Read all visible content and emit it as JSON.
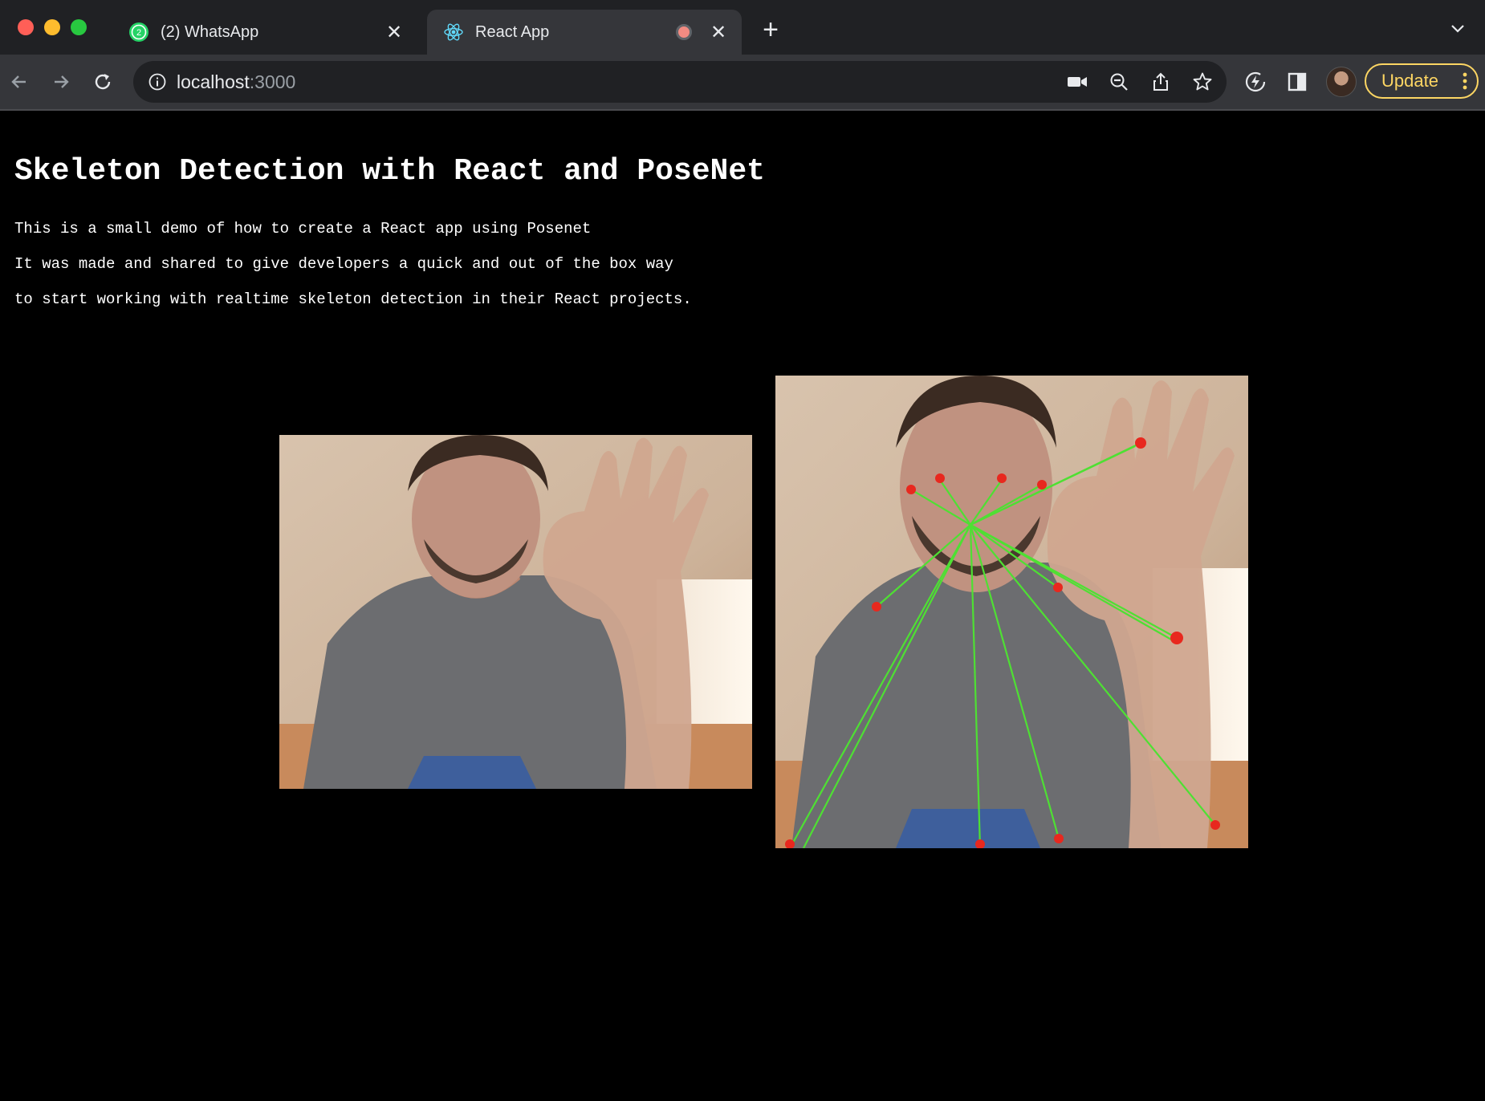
{
  "browser": {
    "tabs": [
      {
        "title": "(2) WhatsApp",
        "badge": "2",
        "icon": "whatsapp-icon",
        "active": false
      },
      {
        "title": "React App",
        "icon": "react-icon",
        "active": true,
        "recording": true
      }
    ],
    "new_tab_label": "+",
    "url_host": "localhost",
    "url_port": ":3000",
    "update_label": "Update",
    "colors": {
      "accent_update": "#fdd663",
      "tabbar": "#202124",
      "toolbar": "#35363a"
    }
  },
  "page": {
    "title": "Skeleton Detection with React and PoseNet",
    "description": [
      "This is a small demo of how to create a React app using Posenet",
      "It was made and shared to give developers a quick and out of the box way",
      "to start working with realtime skeleton detection in their React projects."
    ],
    "skeleton_colors": {
      "keypoint": "#e8281e",
      "line": "#4ee033"
    }
  }
}
